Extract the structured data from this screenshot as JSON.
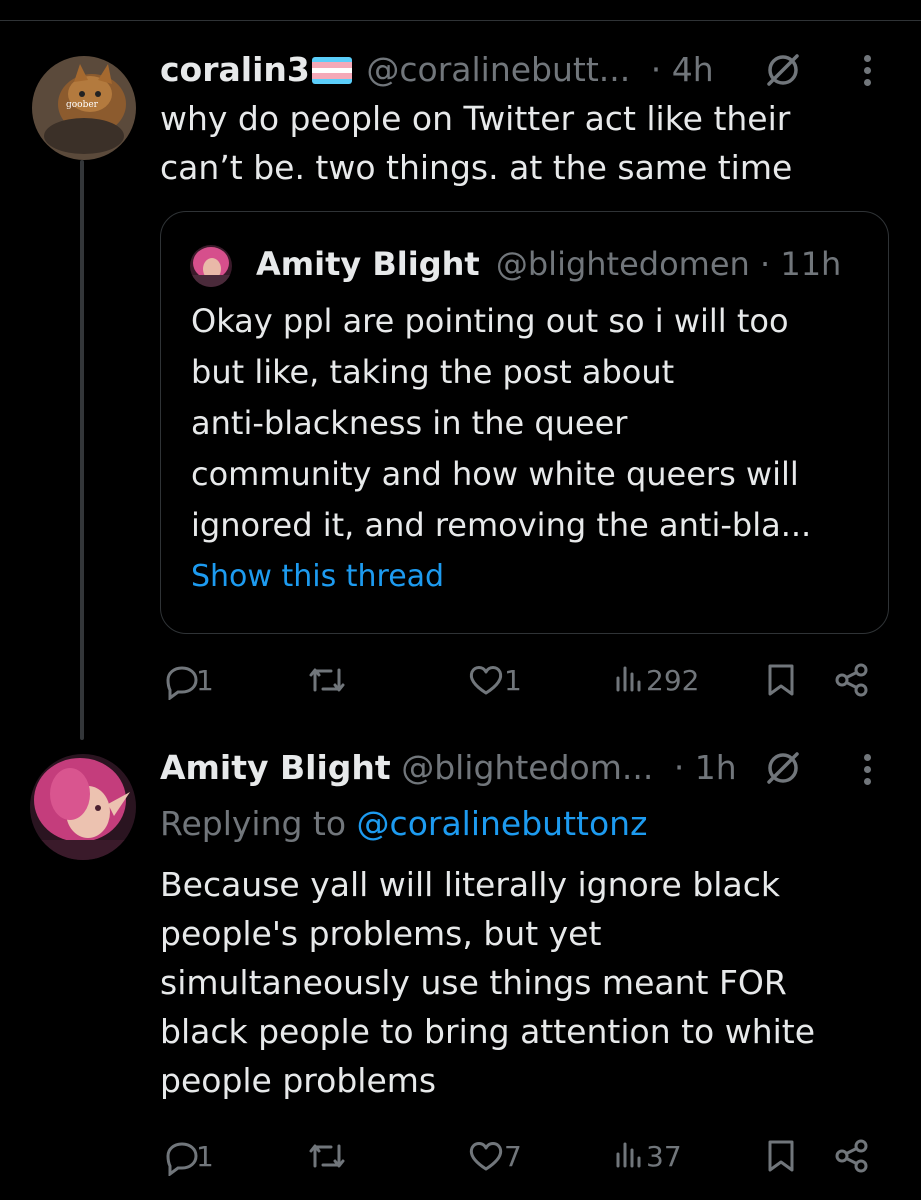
{
  "tweet1": {
    "display_name": "coralin3",
    "handle": "@coralinebutt...",
    "time": "· 4h",
    "avatar_text": "goober",
    "text_lines": [
      "why do people on Twitter act like their",
      "can’t be. two things. at the same time"
    ],
    "replies": "1",
    "likes": "1",
    "views": "292"
  },
  "quote": {
    "display_name": "Amity Blight",
    "handle": "@blightedomen",
    "time": "· 11h",
    "text_lines": [
      "Okay ppl are pointing out so i will too",
      "but like, taking the post about",
      "anti-blackness in the queer",
      "community and how white queers will",
      "ignored it, and removing the anti-bla..."
    ],
    "show_thread": "Show this thread"
  },
  "tweet2": {
    "display_name": "Amity Blight",
    "handle": "@blightedom...",
    "time": "· 1h",
    "replying_prefix": "Replying to",
    "replying_handle": "@coralinebuttonz",
    "text_lines": [
      "Because yall will literally ignore black",
      "people's problems, but yet",
      "simultaneously use things meant FOR",
      "black people to bring attention to white",
      "people problems"
    ],
    "replies": "1",
    "likes": "7",
    "views": "37"
  },
  "icons": {
    "trans_flag": "trans-flag-emoji",
    "no_entry": "no-entry-icon",
    "more": "more-icon",
    "reply": "reply-icon",
    "retweet": "retweet-icon",
    "like": "like-icon",
    "views": "views-icon",
    "bookmark": "bookmark-icon",
    "share": "share-icon"
  },
  "colors": {
    "background": "#000000",
    "text": "#e7e9ea",
    "muted": "#71767b",
    "link": "#1d9bf0",
    "border": "#2f3336"
  }
}
